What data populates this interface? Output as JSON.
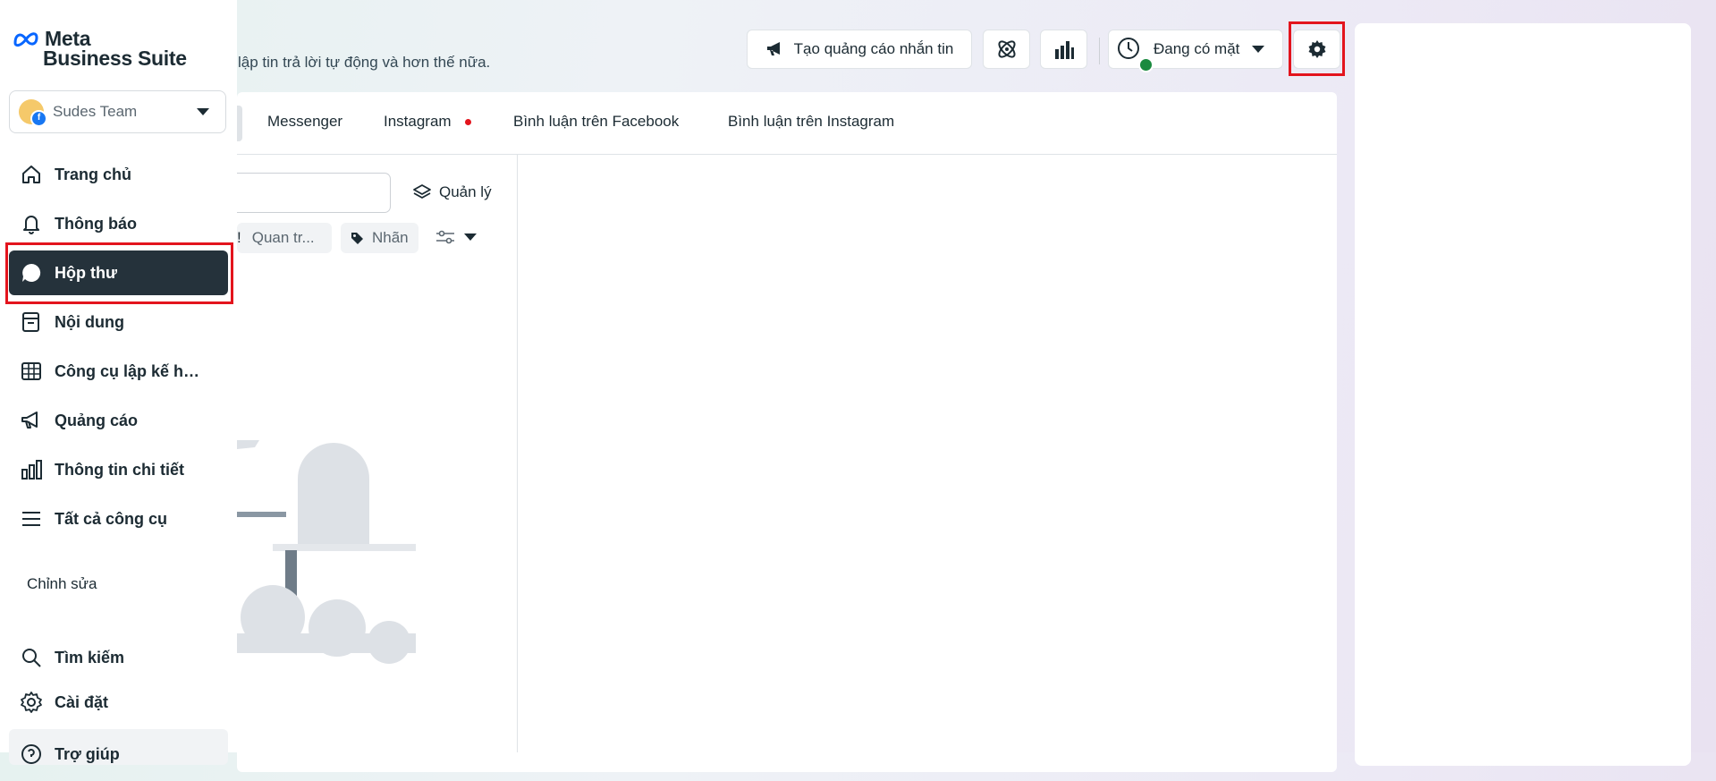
{
  "brand": {
    "line1": "Meta",
    "line2": "Business Suite"
  },
  "account": {
    "name": "Sudes Team"
  },
  "sidebar": {
    "items": [
      {
        "label": "Trang chủ",
        "icon": "home-icon"
      },
      {
        "label": "Thông báo",
        "icon": "bell-icon"
      },
      {
        "label": "Hộp thư",
        "icon": "chat-bubble-icon",
        "active": true
      },
      {
        "label": "Nội dung",
        "icon": "content-icon"
      },
      {
        "label": "Công cụ lập kế hoạch",
        "icon": "calendar-grid-icon"
      },
      {
        "label": "Quảng cáo",
        "icon": "megaphone-icon"
      },
      {
        "label": "Thông tin chi tiết",
        "icon": "bar-chart-icon"
      },
      {
        "label": "Tất cả công cụ",
        "icon": "menu-icon"
      }
    ],
    "edit_label": "Chỉnh sửa",
    "bottom_items": [
      {
        "label": "Tìm kiếm",
        "icon": "search-icon"
      },
      {
        "label": "Cài đặt",
        "icon": "gear-icon"
      },
      {
        "label": "Trợ giúp",
        "icon": "help-icon"
      }
    ]
  },
  "header": {
    "subtitle": "lập tin trả lời tự động và hơn thế nữa.",
    "create_ad_label": "Tạo quảng cáo nhắn tin",
    "status_label": "Đang có mặt"
  },
  "tabs": [
    {
      "label": "Messenger"
    },
    {
      "label": "Instagram",
      "has_dot": true
    },
    {
      "label": "Bình luận trên Facebook"
    },
    {
      "label": "Bình luận trên Instagram"
    }
  ],
  "toolbar": {
    "manage_label": "Quản lý",
    "filter_chip_label": "Quan tr...",
    "tag_chip_label": "Nhãn"
  },
  "colors": {
    "active_nav_bg": "#25323b",
    "highlight_red": "#e3141d",
    "online_green": "#1a8a3f",
    "notification_dot": "#e3141d"
  }
}
